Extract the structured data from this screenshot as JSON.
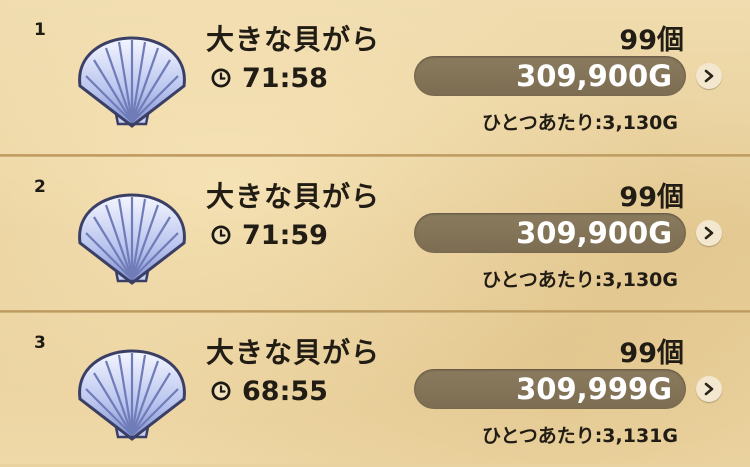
{
  "listings": [
    {
      "rank": "1",
      "item_name": "大きな貝がら",
      "time_left": "71:58",
      "quantity": "99個",
      "price": "309,900G",
      "unit_price": "ひとつあたり:3,130G"
    },
    {
      "rank": "2",
      "item_name": "大きな貝がら",
      "time_left": "71:59",
      "quantity": "99個",
      "price": "309,900G",
      "unit_price": "ひとつあたり:3,130G"
    },
    {
      "rank": "3",
      "item_name": "大きな貝がら",
      "time_left": "68:55",
      "quantity": "99個",
      "price": "309,999G",
      "unit_price": "ひとつあたり:3,131G"
    }
  ],
  "icons": {
    "item": "scallop-shell-icon",
    "timer": "clock-icon",
    "detail": "chevron-right-icon"
  },
  "colors": {
    "background": "#e9d2a0",
    "price_pill": "#84745a",
    "text": "#211c14",
    "shell": "#8f9fd8"
  }
}
